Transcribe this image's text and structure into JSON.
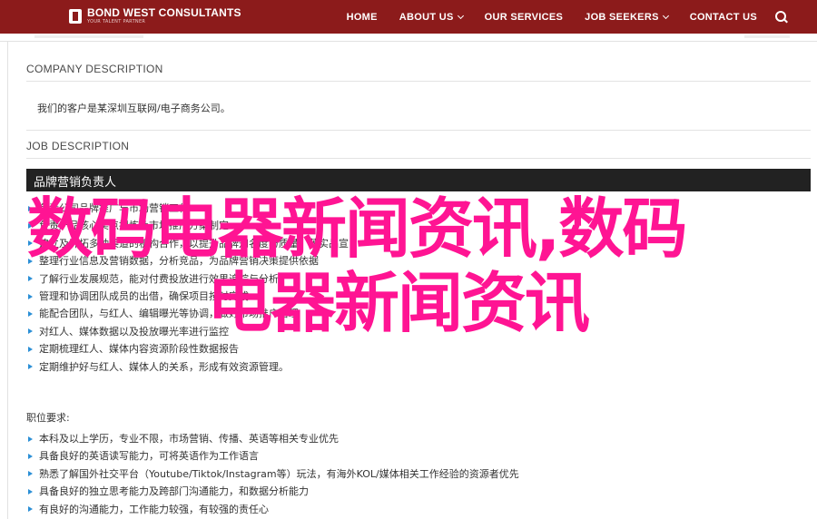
{
  "brand": {
    "name": "BOND WEST CONSULTANTS",
    "tagline": "YOUR TALENT PARTNER"
  },
  "nav": {
    "home": "HOME",
    "about": "ABOUT US",
    "services": "OUR SERVICES",
    "jobseekers": "JOB SEEKERS",
    "contact": "CONTACT US"
  },
  "company": {
    "heading": "COMPANY DESCRIPTION",
    "text": "我们的客户是某深圳互联网/电子商务公司。"
  },
  "job": {
    "heading": "JOB DESCRIPTION",
    "title_band": "品牌营销负责人",
    "duties": [
      "负责公司品牌推广与市场营销工作",
      "负责产品核心卖点提炼及市场推广方案制定",
      "建立及开拓多种渠道的机构合作，以提升品牌知名度与质量，落实品宣",
      "整理行业信息及营销数据，分析竞品，为品牌营销决策提供依据",
      "了解行业发展规范，能对付费投放进行效果追踪与分析",
      "管理和协调团队成员的出借，确保项目按时完成",
      "能配合团队，与红人、编辑曝光等协调，做好市场推广管理",
      "对红人、媒体数据以及投放曝光率进行监控",
      "定期梳理红人、媒体内容资源阶段性数据报告",
      "定期维护好与红人、媒体人的关系，形成有效资源管理。"
    ],
    "req_label": "职位要求:",
    "requirements": [
      "本科及以上学历，专业不限，市场营销、传播、英语等相关专业优先",
      "具备良好的英语读写能力，可将英语作为工作语言",
      "熟悉了解国外社交平台（Youtube/Tiktok/Instagram等）玩法，有海外KOL/媒体相关工作经验的资源者优先",
      "具备良好的独立思考能力及跨部门沟通能力，和数据分析能力",
      "有良好的沟通能力，工作能力较强，有较强的责任心"
    ]
  },
  "overlay": {
    "line1": "数码电器新闻资讯,数码",
    "line2": "电器新闻资讯",
    "color": "#ff1493"
  },
  "colors": {
    "nav_bg": "#8c1b1b",
    "band_bg": "#222222",
    "bullet": "#2b8fd6"
  },
  "icons": {
    "logo": "building-icon",
    "search": "search-icon",
    "bullet": "arrow-right-icon"
  }
}
